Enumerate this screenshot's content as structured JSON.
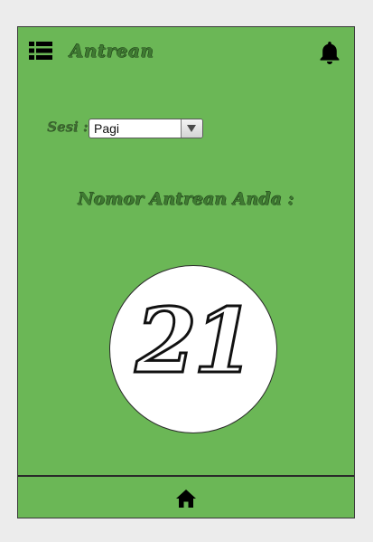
{
  "header": {
    "title": "Antrean",
    "menu_icon": "list-menu-icon",
    "notification_icon": "bell-icon"
  },
  "session": {
    "label": "Sesi :",
    "selected": "Pagi"
  },
  "queue": {
    "label": "Nomor Antrean Anda :",
    "number": "21"
  },
  "bottom_nav": {
    "home_icon": "home-icon"
  },
  "colors": {
    "background": "#6bb756",
    "page": "#ececec",
    "title_text": "#3f7a32"
  }
}
